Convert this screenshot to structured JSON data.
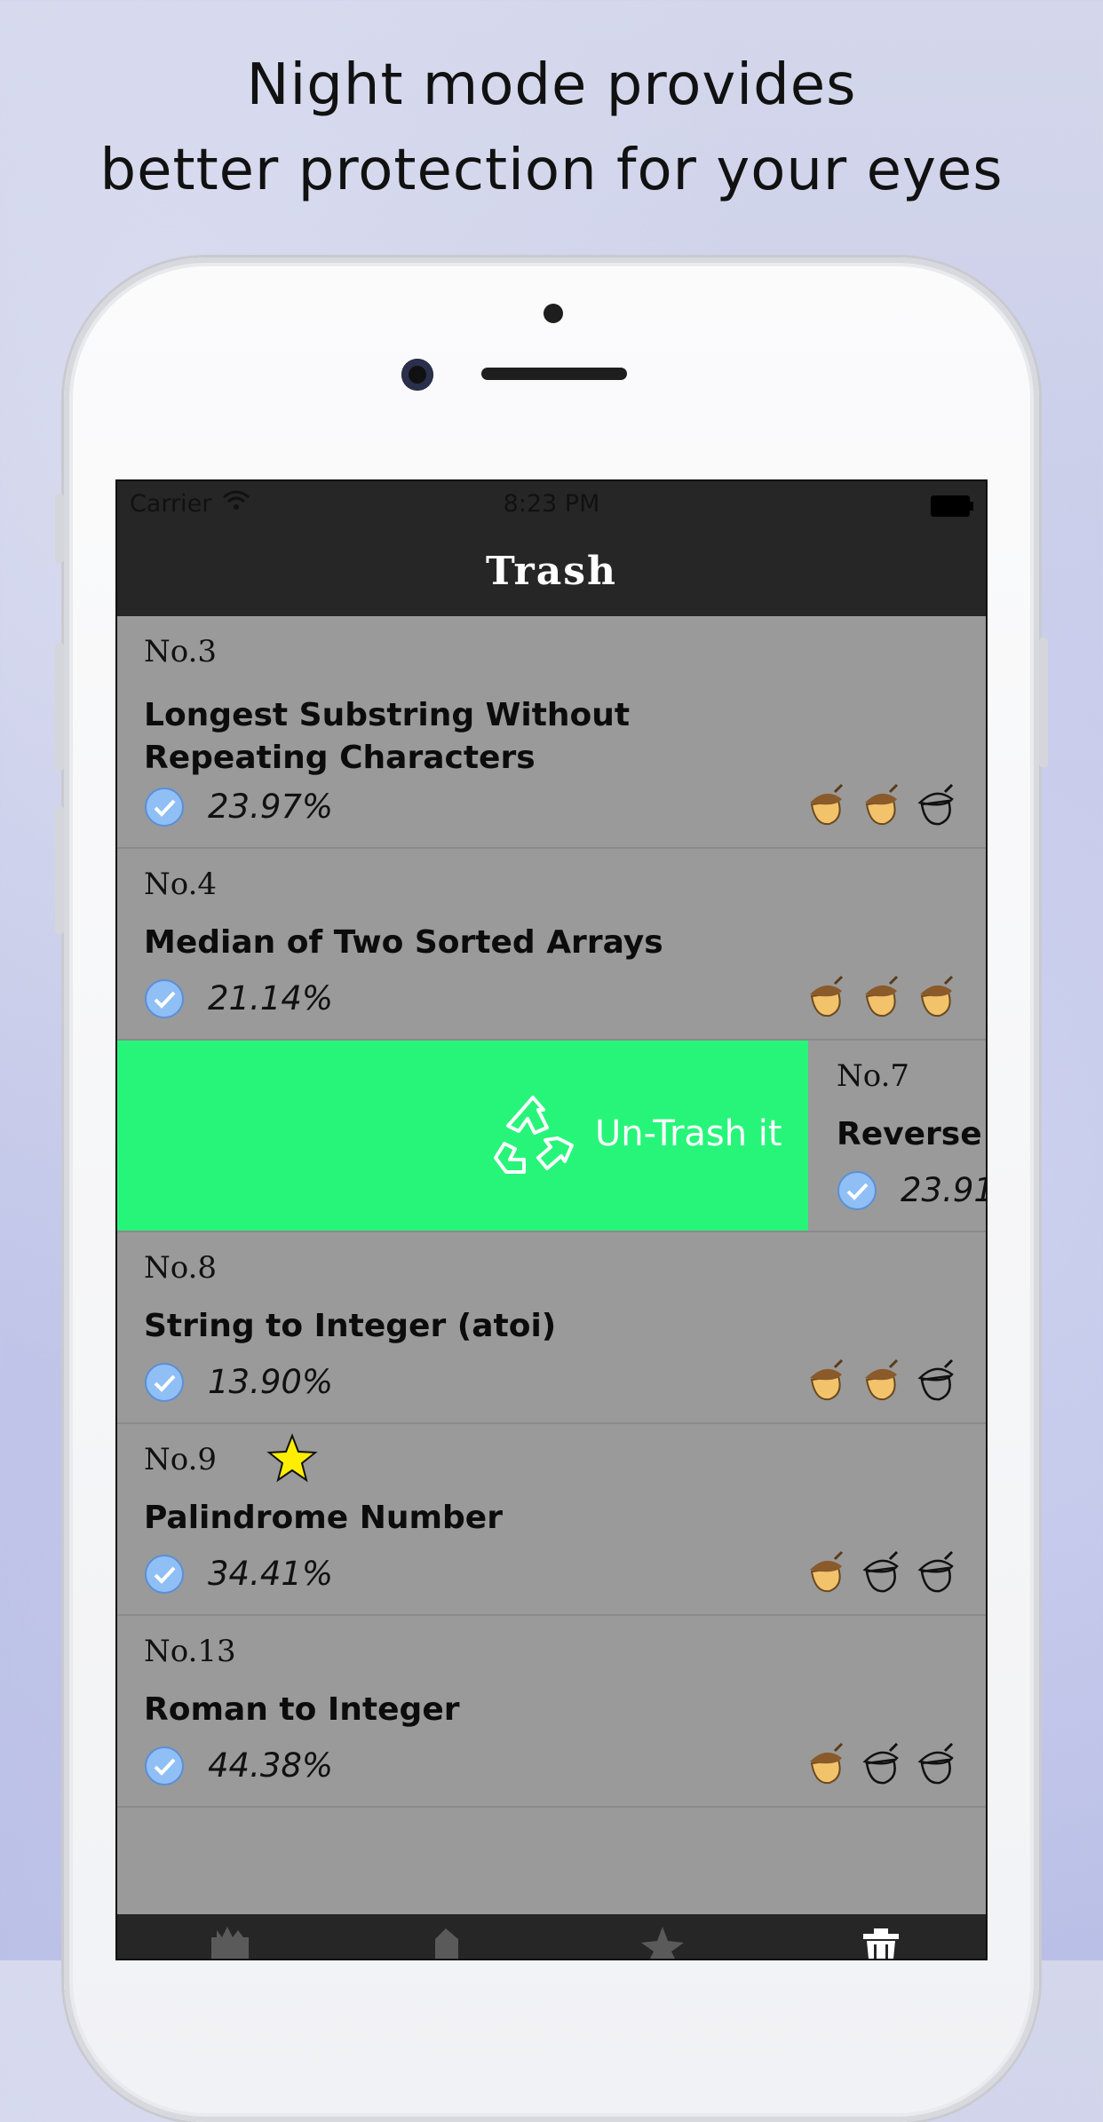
{
  "headline": {
    "line1": "Night mode provides",
    "line2": "better protection for your eyes"
  },
  "status_bar": {
    "carrier": "Carrier",
    "time": "8:23 PM"
  },
  "nav": {
    "title": "Trash"
  },
  "colors": {
    "screen_bg": "#9a9a9a",
    "bar_bg": "#262626",
    "untrash_green": "#27f57a",
    "check_blue": "#8fbff5",
    "acorn_filled": "#f2c36b",
    "star_yellow": "#ffee00"
  },
  "swipe_action": {
    "label": "Un-Trash it",
    "icon": "recycle-icon"
  },
  "problems": [
    {
      "no": "No.3",
      "title": "Longest Substring Without Repeating Characters",
      "rate": "23.97%",
      "starred": false,
      "difficulty": [
        true,
        true,
        false
      ]
    },
    {
      "no": "No.4",
      "title": "Median of Two Sorted Arrays",
      "rate": "21.14%",
      "starred": false,
      "difficulty": [
        true,
        true,
        true
      ]
    },
    {
      "no": "No.7",
      "title": "Reverse I",
      "rate": "23.91",
      "starred": false,
      "swiped": true
    },
    {
      "no": "No.8",
      "title": "String to Integer (atoi)",
      "rate": "13.90%",
      "starred": false,
      "difficulty": [
        true,
        true,
        false
      ]
    },
    {
      "no": "No.9",
      "title": "Palindrome Number",
      "rate": "34.41%",
      "starred": true,
      "difficulty": [
        true,
        false,
        false
      ]
    },
    {
      "no": "No.13",
      "title": "Roman to Integer",
      "rate": "44.38%",
      "starred": false,
      "difficulty": [
        true,
        false,
        false
      ]
    }
  ],
  "tabs": [
    {
      "icon": "castle-icon"
    },
    {
      "icon": "tag-icon"
    },
    {
      "icon": "star-icon"
    },
    {
      "icon": "trash-icon",
      "active": true
    }
  ]
}
